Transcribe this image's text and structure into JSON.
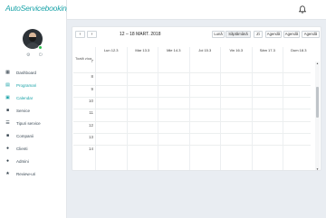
{
  "app": {
    "logo": "AutoServicebooking"
  },
  "sidebar": {
    "actions": "⚙ ⏻",
    "items": [
      {
        "label": "Dashboard",
        "icon": "grid-icon",
        "glyph": "▦",
        "active": false
      },
      {
        "label": "Programari",
        "icon": "calendar-check-icon",
        "glyph": "▤",
        "active": true
      },
      {
        "label": "Calendar",
        "icon": "calendar-icon",
        "glyph": "▣",
        "active": true
      },
      {
        "label": "Service",
        "icon": "wrench-icon",
        "glyph": "■",
        "active": false
      },
      {
        "label": "Tipuri service",
        "icon": "list-icon",
        "glyph": "☰",
        "active": false
      },
      {
        "label": "Companii",
        "icon": "building-icon",
        "glyph": "■",
        "active": false
      },
      {
        "label": "Clienti",
        "icon": "user-icon",
        "glyph": "●",
        "active": false
      },
      {
        "label": "Admini",
        "icon": "user-shield-icon",
        "glyph": "●",
        "active": false
      },
      {
        "label": "Review-uri",
        "icon": "star-icon",
        "glyph": "★",
        "active": false
      }
    ]
  },
  "calendar": {
    "prev": "‹",
    "next": "›",
    "title": "12 – 18 MART. 2018",
    "views": [
      "Lună",
      "Săptămână",
      "Zi",
      "Agendă",
      "Agendă",
      "Agendă"
    ],
    "active_view": 1,
    "days": [
      "Lun 12.3",
      "Mar 13.3",
      "Mie 14.3",
      "Joi 15.3",
      "Vin 16.3",
      "Sâm 17.3",
      "Dum 18.3"
    ],
    "all_day_label": "Toată ziua",
    "hours": [
      "8",
      "9",
      "10",
      "11",
      "12",
      "13",
      "14"
    ],
    "hour_above": "7"
  },
  "colors": {
    "accent": "#1aa3a8"
  }
}
